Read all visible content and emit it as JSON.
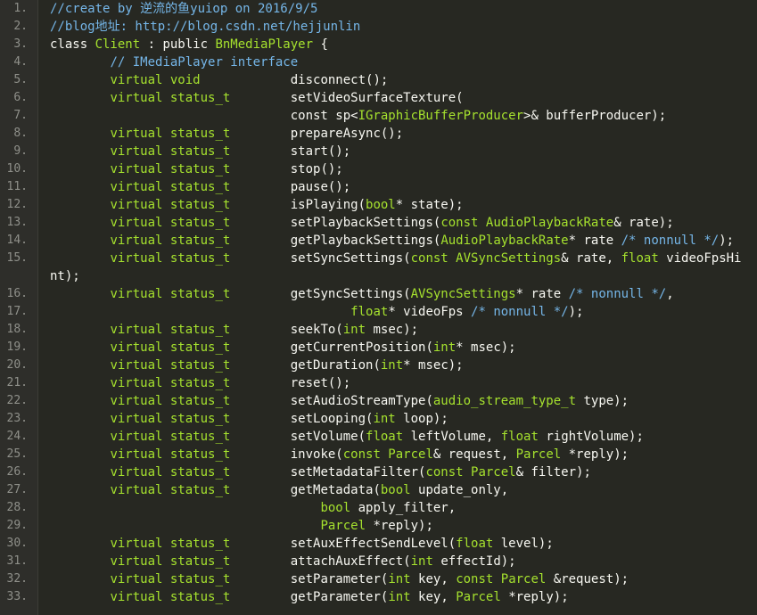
{
  "editor": {
    "colors": {
      "background": "#272822",
      "gutter": "#2e2e2a",
      "line_number": "#8f908a",
      "text": "#f8f8f2",
      "comment": "#75b6e8",
      "type": "#a6e22e"
    },
    "lines": [
      {
        "number": "1.",
        "tokens": [
          {
            "t": "comment",
            "v": "//create by 逆流的鱼yuiop on 2016/9/5"
          }
        ]
      },
      {
        "number": "2.",
        "tokens": [
          {
            "t": "comment",
            "v": "//blog地址: http://blog.csdn.net/hejjunlin"
          }
        ]
      },
      {
        "number": "3.",
        "tokens": [
          {
            "t": "plain",
            "v": "class "
          },
          {
            "t": "type",
            "v": "Client"
          },
          {
            "t": "plain",
            "v": " : public "
          },
          {
            "t": "type",
            "v": "BnMediaPlayer"
          },
          {
            "t": "plain",
            "v": " {"
          }
        ]
      },
      {
        "number": "4.",
        "tokens": [
          {
            "t": "plain",
            "v": "        "
          },
          {
            "t": "comment",
            "v": "// IMediaPlayer interface"
          }
        ]
      },
      {
        "number": "5.",
        "tokens": [
          {
            "t": "plain",
            "v": "        "
          },
          {
            "t": "type",
            "v": "virtual void"
          },
          {
            "t": "plain",
            "v": "            disconnect();"
          }
        ]
      },
      {
        "number": "6.",
        "tokens": [
          {
            "t": "plain",
            "v": "        "
          },
          {
            "t": "type",
            "v": "virtual status_t"
          },
          {
            "t": "plain",
            "v": "        setVideoSurfaceTexture("
          }
        ]
      },
      {
        "number": "7.",
        "tokens": [
          {
            "t": "plain",
            "v": "                                const sp<"
          },
          {
            "t": "type",
            "v": "IGraphicBufferProducer"
          },
          {
            "t": "plain",
            "v": ">& bufferProducer);"
          }
        ]
      },
      {
        "number": "8.",
        "tokens": [
          {
            "t": "plain",
            "v": "        "
          },
          {
            "t": "type",
            "v": "virtual status_t"
          },
          {
            "t": "plain",
            "v": "        prepareAsync();"
          }
        ]
      },
      {
        "number": "9.",
        "tokens": [
          {
            "t": "plain",
            "v": "        "
          },
          {
            "t": "type",
            "v": "virtual status_t"
          },
          {
            "t": "plain",
            "v": "        start();"
          }
        ]
      },
      {
        "number": "10.",
        "tokens": [
          {
            "t": "plain",
            "v": "        "
          },
          {
            "t": "type",
            "v": "virtual status_t"
          },
          {
            "t": "plain",
            "v": "        stop();"
          }
        ]
      },
      {
        "number": "11.",
        "tokens": [
          {
            "t": "plain",
            "v": "        "
          },
          {
            "t": "type",
            "v": "virtual status_t"
          },
          {
            "t": "plain",
            "v": "        pause();"
          }
        ]
      },
      {
        "number": "12.",
        "tokens": [
          {
            "t": "plain",
            "v": "        "
          },
          {
            "t": "type",
            "v": "virtual status_t"
          },
          {
            "t": "plain",
            "v": "        isPlaying("
          },
          {
            "t": "type",
            "v": "bool"
          },
          {
            "t": "plain",
            "v": "* state);"
          }
        ]
      },
      {
        "number": "13.",
        "tokens": [
          {
            "t": "plain",
            "v": "        "
          },
          {
            "t": "type",
            "v": "virtual status_t"
          },
          {
            "t": "plain",
            "v": "        setPlaybackSettings("
          },
          {
            "t": "type",
            "v": "const AudioPlaybackRate"
          },
          {
            "t": "plain",
            "v": "& rate);"
          }
        ]
      },
      {
        "number": "14.",
        "tokens": [
          {
            "t": "plain",
            "v": "        "
          },
          {
            "t": "type",
            "v": "virtual status_t"
          },
          {
            "t": "plain",
            "v": "        getPlaybackSettings("
          },
          {
            "t": "type",
            "v": "AudioPlaybackRate"
          },
          {
            "t": "plain",
            "v": "* rate "
          },
          {
            "t": "comment",
            "v": "/* nonnull */"
          },
          {
            "t": "plain",
            "v": ");"
          }
        ]
      },
      {
        "number": "15.",
        "tokens": [
          {
            "t": "plain",
            "v": "        "
          },
          {
            "t": "type",
            "v": "virtual status_t"
          },
          {
            "t": "plain",
            "v": "        setSyncSettings("
          },
          {
            "t": "type",
            "v": "const AVSyncSettings"
          },
          {
            "t": "plain",
            "v": "& rate, "
          },
          {
            "t": "type",
            "v": "float"
          },
          {
            "t": "plain",
            "v": " videoFpsHi"
          }
        ]
      },
      {
        "number": "",
        "tokens": [
          {
            "t": "plain",
            "v": "nt);"
          }
        ]
      },
      {
        "number": "16.",
        "tokens": [
          {
            "t": "plain",
            "v": "        "
          },
          {
            "t": "type",
            "v": "virtual status_t"
          },
          {
            "t": "plain",
            "v": "        getSyncSettings("
          },
          {
            "t": "type",
            "v": "AVSyncSettings"
          },
          {
            "t": "plain",
            "v": "* rate "
          },
          {
            "t": "comment",
            "v": "/* nonnull */"
          },
          {
            "t": "plain",
            "v": ","
          }
        ]
      },
      {
        "number": "17.",
        "tokens": [
          {
            "t": "plain",
            "v": "                                        "
          },
          {
            "t": "type",
            "v": "float"
          },
          {
            "t": "plain",
            "v": "* videoFps "
          },
          {
            "t": "comment",
            "v": "/* nonnull */"
          },
          {
            "t": "plain",
            "v": ");"
          }
        ]
      },
      {
        "number": "18.",
        "tokens": [
          {
            "t": "plain",
            "v": "        "
          },
          {
            "t": "type",
            "v": "virtual status_t"
          },
          {
            "t": "plain",
            "v": "        seekTo("
          },
          {
            "t": "type",
            "v": "int"
          },
          {
            "t": "plain",
            "v": " msec);"
          }
        ]
      },
      {
        "number": "19.",
        "tokens": [
          {
            "t": "plain",
            "v": "        "
          },
          {
            "t": "type",
            "v": "virtual status_t"
          },
          {
            "t": "plain",
            "v": "        getCurrentPosition("
          },
          {
            "t": "type",
            "v": "int"
          },
          {
            "t": "plain",
            "v": "* msec);"
          }
        ]
      },
      {
        "number": "20.",
        "tokens": [
          {
            "t": "plain",
            "v": "        "
          },
          {
            "t": "type",
            "v": "virtual status_t"
          },
          {
            "t": "plain",
            "v": "        getDuration("
          },
          {
            "t": "type",
            "v": "int"
          },
          {
            "t": "plain",
            "v": "* msec);"
          }
        ]
      },
      {
        "number": "21.",
        "tokens": [
          {
            "t": "plain",
            "v": "        "
          },
          {
            "t": "type",
            "v": "virtual status_t"
          },
          {
            "t": "plain",
            "v": "        reset();"
          }
        ]
      },
      {
        "number": "22.",
        "tokens": [
          {
            "t": "plain",
            "v": "        "
          },
          {
            "t": "type",
            "v": "virtual status_t"
          },
          {
            "t": "plain",
            "v": "        setAudioStreamType("
          },
          {
            "t": "type",
            "v": "audio_stream_type_t"
          },
          {
            "t": "plain",
            "v": " type);"
          }
        ]
      },
      {
        "number": "23.",
        "tokens": [
          {
            "t": "plain",
            "v": "        "
          },
          {
            "t": "type",
            "v": "virtual status_t"
          },
          {
            "t": "plain",
            "v": "        setLooping("
          },
          {
            "t": "type",
            "v": "int"
          },
          {
            "t": "plain",
            "v": " loop);"
          }
        ]
      },
      {
        "number": "24.",
        "tokens": [
          {
            "t": "plain",
            "v": "        "
          },
          {
            "t": "type",
            "v": "virtual status_t"
          },
          {
            "t": "plain",
            "v": "        setVolume("
          },
          {
            "t": "type",
            "v": "float"
          },
          {
            "t": "plain",
            "v": " leftVolume, "
          },
          {
            "t": "type",
            "v": "float"
          },
          {
            "t": "plain",
            "v": " rightVolume);"
          }
        ]
      },
      {
        "number": "25.",
        "tokens": [
          {
            "t": "plain",
            "v": "        "
          },
          {
            "t": "type",
            "v": "virtual status_t"
          },
          {
            "t": "plain",
            "v": "        invoke("
          },
          {
            "t": "type",
            "v": "const Parcel"
          },
          {
            "t": "plain",
            "v": "& request, "
          },
          {
            "t": "type",
            "v": "Parcel"
          },
          {
            "t": "plain",
            "v": " *reply);"
          }
        ]
      },
      {
        "number": "26.",
        "tokens": [
          {
            "t": "plain",
            "v": "        "
          },
          {
            "t": "type",
            "v": "virtual status_t"
          },
          {
            "t": "plain",
            "v": "        setMetadataFilter("
          },
          {
            "t": "type",
            "v": "const Parcel"
          },
          {
            "t": "plain",
            "v": "& filter);"
          }
        ]
      },
      {
        "number": "27.",
        "tokens": [
          {
            "t": "plain",
            "v": "        "
          },
          {
            "t": "type",
            "v": "virtual status_t"
          },
          {
            "t": "plain",
            "v": "        getMetadata("
          },
          {
            "t": "type",
            "v": "bool"
          },
          {
            "t": "plain",
            "v": " update_only,"
          }
        ]
      },
      {
        "number": "28.",
        "tokens": [
          {
            "t": "plain",
            "v": "                                    "
          },
          {
            "t": "type",
            "v": "bool"
          },
          {
            "t": "plain",
            "v": " apply_filter,"
          }
        ]
      },
      {
        "number": "29.",
        "tokens": [
          {
            "t": "plain",
            "v": "                                    "
          },
          {
            "t": "type",
            "v": "Parcel"
          },
          {
            "t": "plain",
            "v": " *reply);"
          }
        ]
      },
      {
        "number": "30.",
        "tokens": [
          {
            "t": "plain",
            "v": "        "
          },
          {
            "t": "type",
            "v": "virtual status_t"
          },
          {
            "t": "plain",
            "v": "        setAuxEffectSendLevel("
          },
          {
            "t": "type",
            "v": "float"
          },
          {
            "t": "plain",
            "v": " level);"
          }
        ]
      },
      {
        "number": "31.",
        "tokens": [
          {
            "t": "plain",
            "v": "        "
          },
          {
            "t": "type",
            "v": "virtual status_t"
          },
          {
            "t": "plain",
            "v": "        attachAuxEffect("
          },
          {
            "t": "type",
            "v": "int"
          },
          {
            "t": "plain",
            "v": " effectId);"
          }
        ]
      },
      {
        "number": "32.",
        "tokens": [
          {
            "t": "plain",
            "v": "        "
          },
          {
            "t": "type",
            "v": "virtual status_t"
          },
          {
            "t": "plain",
            "v": "        setParameter("
          },
          {
            "t": "type",
            "v": "int"
          },
          {
            "t": "plain",
            "v": " key, "
          },
          {
            "t": "type",
            "v": "const Parcel"
          },
          {
            "t": "plain",
            "v": " &request);"
          }
        ]
      },
      {
        "number": "33.",
        "tokens": [
          {
            "t": "plain",
            "v": "        "
          },
          {
            "t": "type",
            "v": "virtual status_t"
          },
          {
            "t": "plain",
            "v": "        getParameter("
          },
          {
            "t": "type",
            "v": "int"
          },
          {
            "t": "plain",
            "v": " key, "
          },
          {
            "t": "type",
            "v": "Parcel"
          },
          {
            "t": "plain",
            "v": " *reply);"
          }
        ]
      }
    ]
  }
}
